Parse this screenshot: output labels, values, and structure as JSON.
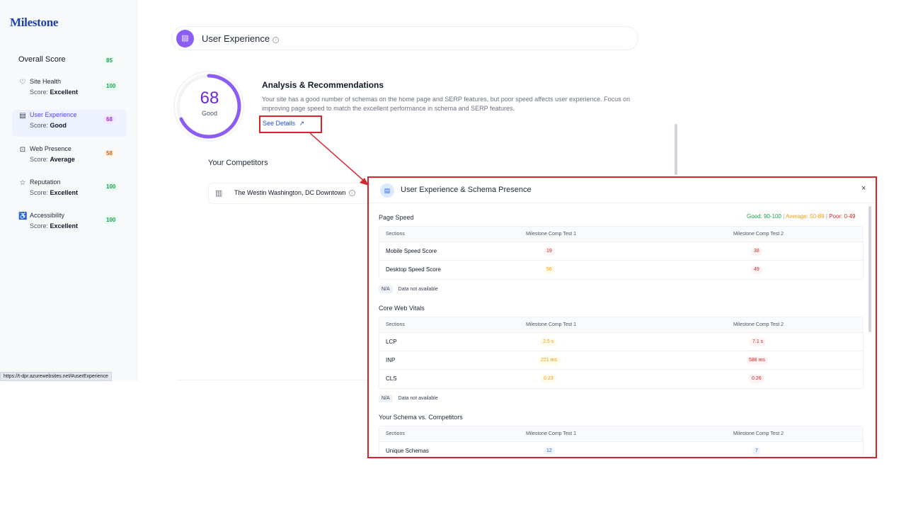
{
  "sidebar": {
    "logo": "Milestone",
    "overall_label": "Overall Score",
    "overall_score": "85",
    "items": [
      {
        "label": "Site Health",
        "score_prefix": "Score: ",
        "score_word": "Excellent",
        "value": "100",
        "icon": "heart-pulse-icon"
      },
      {
        "label": "User Experience",
        "score_prefix": "Score: ",
        "score_word": "Good",
        "value": "68",
        "icon": "browser-icon"
      },
      {
        "label": "Web Presence",
        "score_prefix": "Score: ",
        "score_word": "Average",
        "value": "58",
        "icon": "code-window-icon"
      },
      {
        "label": "Reputation",
        "score_prefix": "Score: ",
        "score_word": "Excellent",
        "value": "100",
        "icon": "star-icon"
      },
      {
        "label": "Accessibility",
        "score_prefix": "Score: ",
        "score_word": "Excellent",
        "value": "100",
        "icon": "wheelchair-icon"
      }
    ],
    "status_url": "https://t-dpr.azurewebsites.net/#userExperience"
  },
  "main": {
    "title": "User Experience",
    "gauge_value": "68",
    "gauge_fraction": 0.68,
    "gauge_label": "Good",
    "analysis_title": "Analysis & Recommendations",
    "analysis_text": "Your site has a good number of schemas on the home page and SERP features, but poor speed affects user experience. Focus on improving page speed to match the excellent performance in schema and SERP features.",
    "see_details": "See Details",
    "competitors_title": "Your Competitors",
    "competitor_name": "The Westin Washington, DC Downtown"
  },
  "modal": {
    "title": "User Experience & Schema Presence",
    "close": "×",
    "legend": {
      "good": "Good: 90-100",
      "average": "Average: 50-89",
      "poor": "Poor: 0-49",
      "sep": "|"
    },
    "columns": [
      "Sections",
      "Milestone Comp Test 1",
      "Milestone Comp Test 2"
    ],
    "page_speed": {
      "title": "Page Speed",
      "rows": [
        {
          "name": "Mobile Speed Score",
          "v1": "19",
          "v2": "38"
        },
        {
          "name": "Desktop Speed Score",
          "v1": "56",
          "v2": "49"
        }
      ]
    },
    "na_badge": "N/A",
    "na_text": "Data not available",
    "core_web_vitals": {
      "title": "Core Web Vitals",
      "rows": [
        {
          "name": "LCP",
          "v1": "2.5 s",
          "v2": "7.1 s"
        },
        {
          "name": "INP",
          "v1": "221 ms",
          "v2": "588 ms"
        },
        {
          "name": "CLS",
          "v1": "0.23",
          "v2": "0.26"
        }
      ]
    },
    "schema": {
      "title": "Your Schema vs. Competitors",
      "rows": [
        {
          "name": "Unique Schemas",
          "v1": "12",
          "v2": "7"
        }
      ]
    }
  },
  "colors": {
    "accent": "#8b5cf6",
    "highlight_border": "#d9232d",
    "good": "#16a34a",
    "average": "#f59e0b",
    "poor": "#dc2626"
  }
}
